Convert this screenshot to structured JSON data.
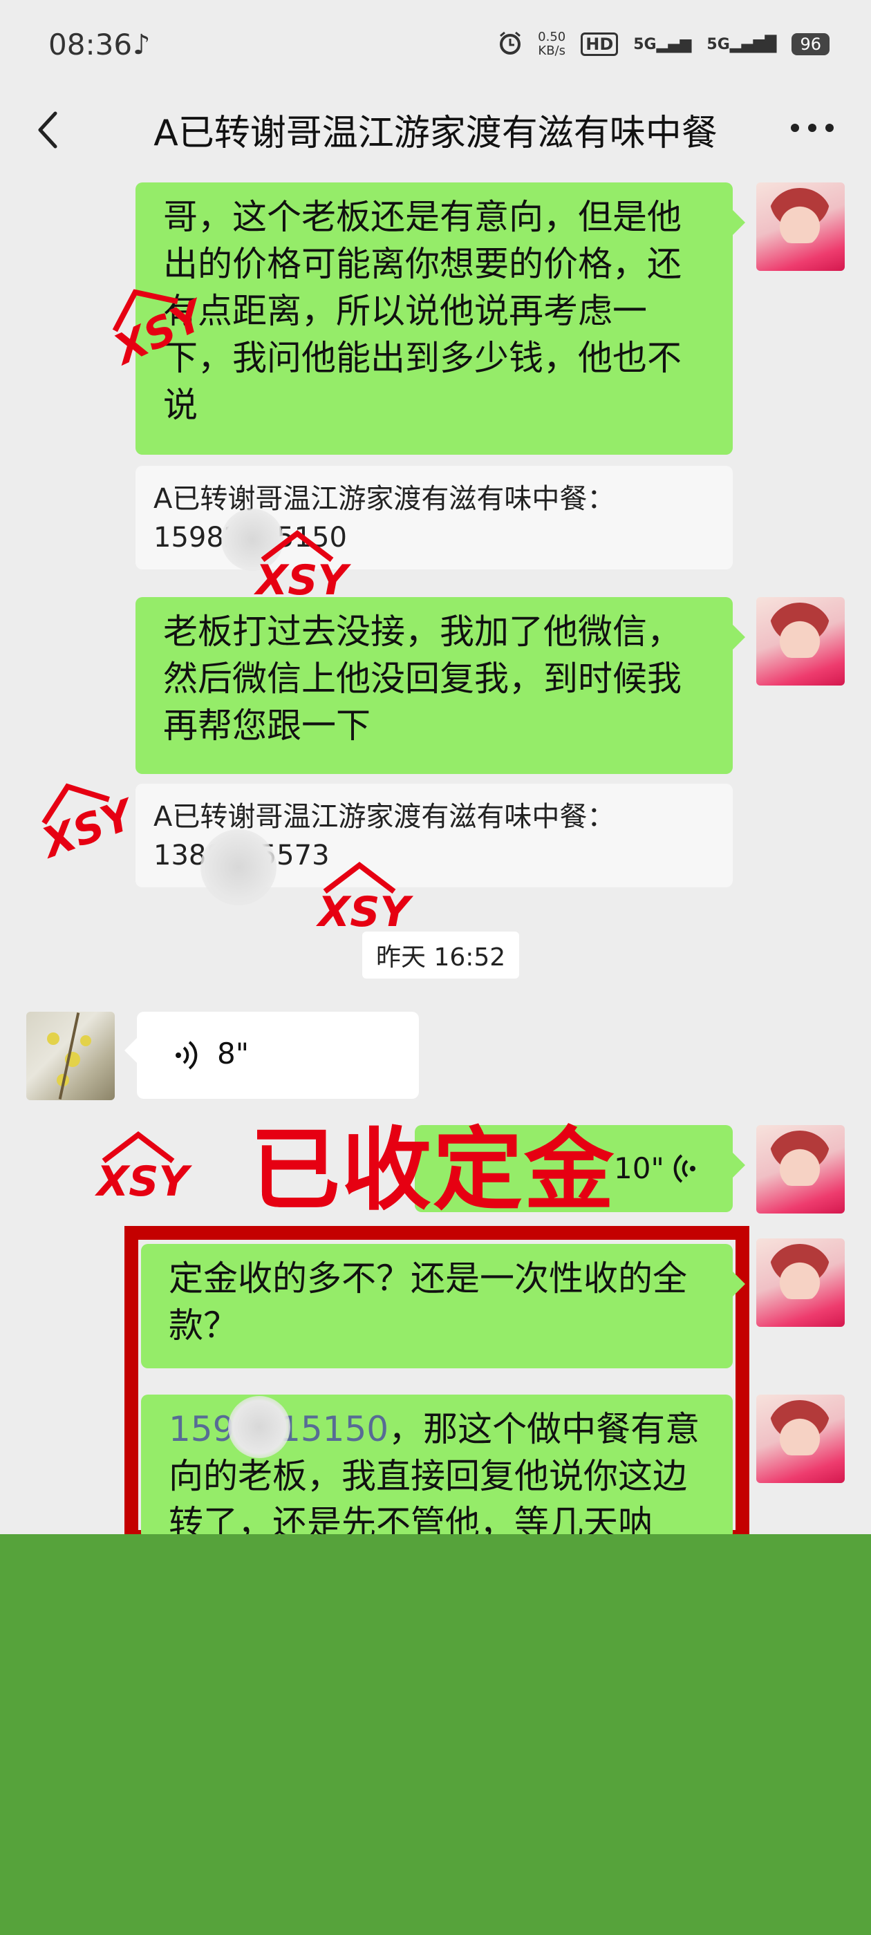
{
  "status_bar": {
    "time": "08:36",
    "net_speed_value": "0.50",
    "net_speed_unit": "KB/s",
    "hd_label": "HD",
    "net1": "5G",
    "net2": "5G",
    "battery": "96"
  },
  "header": {
    "title": "A已转谢哥温江游家渡有滋有味中餐"
  },
  "messages": {
    "msg1": "哥，这个老板还是有意向，但是他出的价格可能离你想要的价格，还有点距离，所以说他说再考虑一下，我问他能出到多少钱，他也不说",
    "quote1_label": "A已转谢哥温江游家渡有滋有味中餐：",
    "quote1_phone_a": "15982",
    "quote1_phone_b": "15150",
    "msg2": "老板打过去没接，我加了他微信，然后微信上他没回复我，到时候我再帮您跟一下",
    "quote2_label": "A已转谢哥温江游家渡有滋有味中餐：",
    "quote2_phone_a": "138",
    "quote2_phone_b": "55573",
    "timestamp": "昨天 16:52",
    "voice_in_duration": "8\"",
    "voice_out_duration": "10\"",
    "msg3": "定金收的多不？还是一次性收的全款？",
    "msg4_phone_a": "1598",
    "msg4_phone_b": "15150",
    "msg4_text": "，那这个做中餐有意向的老板，我直接回复他说你这边转了，还是先不管他，等几天呐"
  },
  "overlay": {
    "part1": "已收",
    "part2": "定金"
  },
  "watermark": "XSY",
  "colors": {
    "bubble_self": "#95ec69",
    "overlay_red": "#e60012",
    "frame_red": "#c40000",
    "link_blue": "#576b95",
    "bottom_green": "#56a33b"
  }
}
